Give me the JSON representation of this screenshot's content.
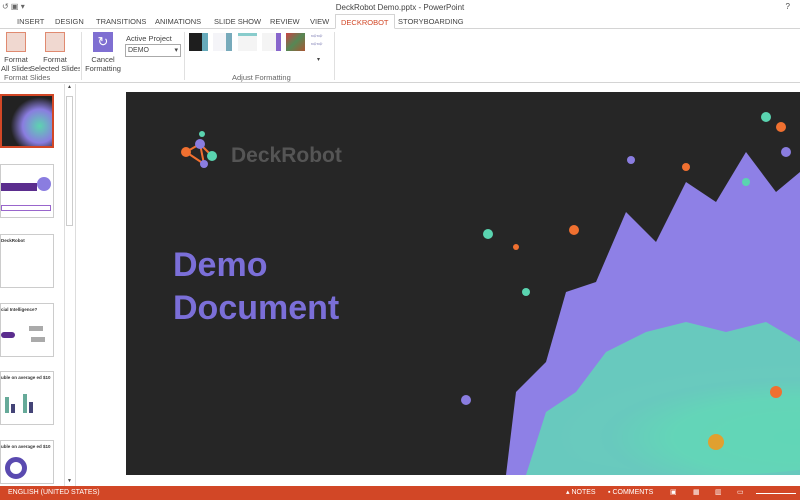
{
  "window": {
    "title": "DeckRobot Demo.pptx - PowerPoint",
    "help": "?"
  },
  "tabs": [
    "INSERT",
    "DESIGN",
    "TRANSITIONS",
    "ANIMATIONS",
    "SLIDE SHOW",
    "REVIEW",
    "VIEW",
    "DECKROBOT",
    "STORYBOARDING"
  ],
  "ribbon": {
    "format_all": "Format All Slides",
    "format_selected": "Format Selected Slides",
    "group_format": "Format Slides",
    "cancel": "Cancel Formatting",
    "active_project_label": "Active Project",
    "active_project_value": "DEMO",
    "group_adjust": "Adjust Formatting"
  },
  "thumbnails": [
    {
      "title": ""
    },
    {
      "title": ""
    },
    {
      "title": "DeckRobot"
    },
    {
      "title": "cial Intelligence?"
    },
    {
      "title": "uble on average ed $10"
    },
    {
      "title": "uble on average ed $10"
    }
  ],
  "slide": {
    "logo": "DeckRobot",
    "title_line1": "Demo",
    "title_line2": "Document"
  },
  "status": {
    "language": "ENGLISH (UNITED STATES)",
    "notes": "NOTES",
    "comments": "COMMENTS"
  },
  "colors": {
    "accent": "#d24726",
    "title": "#7b6fd8",
    "slide_bg": "#262626"
  }
}
